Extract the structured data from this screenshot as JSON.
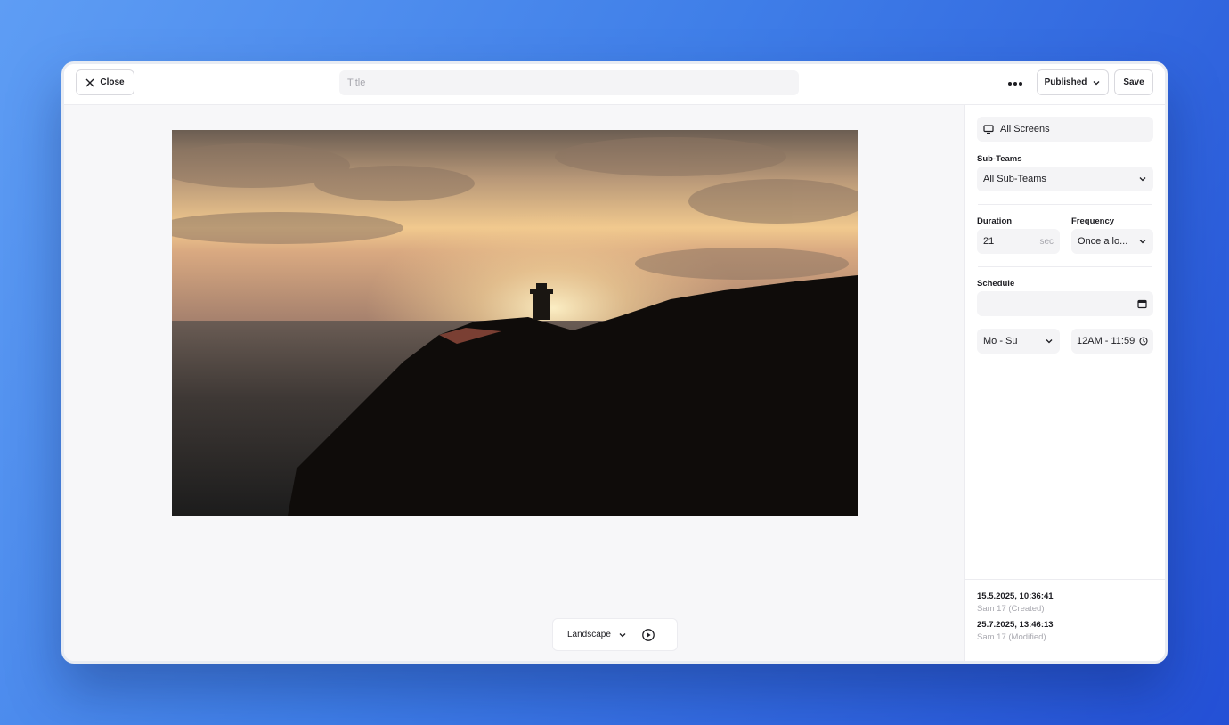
{
  "toolbar": {
    "close_label": "Close",
    "title_placeholder": "Title",
    "title_value": "",
    "status_label": "Published",
    "save_label": "Save"
  },
  "preview": {
    "orientation": "Landscape"
  },
  "sidebar": {
    "screens_label": "All Screens",
    "subteams_label": "Sub-Teams",
    "subteams_value": "All Sub-Teams",
    "duration_label": "Duration",
    "duration_value": "21",
    "duration_unit": "sec",
    "frequency_label": "Frequency",
    "frequency_value": "Once a lo...",
    "schedule_label": "Schedule",
    "schedule_date_value": "",
    "days_value": "Mo - Su",
    "time_value": "12AM - 11:59"
  },
  "meta": {
    "created_date": "15.5.2025, 10:36:41",
    "created_by": "Sam 17 (Created)",
    "modified_date": "25.7.2025, 13:46:13",
    "modified_by": "Sam 17 (Modified)"
  },
  "colors": {
    "background_start": "#5e9df4",
    "background_end": "#2450d6",
    "panel_bg": "#f7f7f9",
    "field_bg": "#f4f4f6"
  }
}
